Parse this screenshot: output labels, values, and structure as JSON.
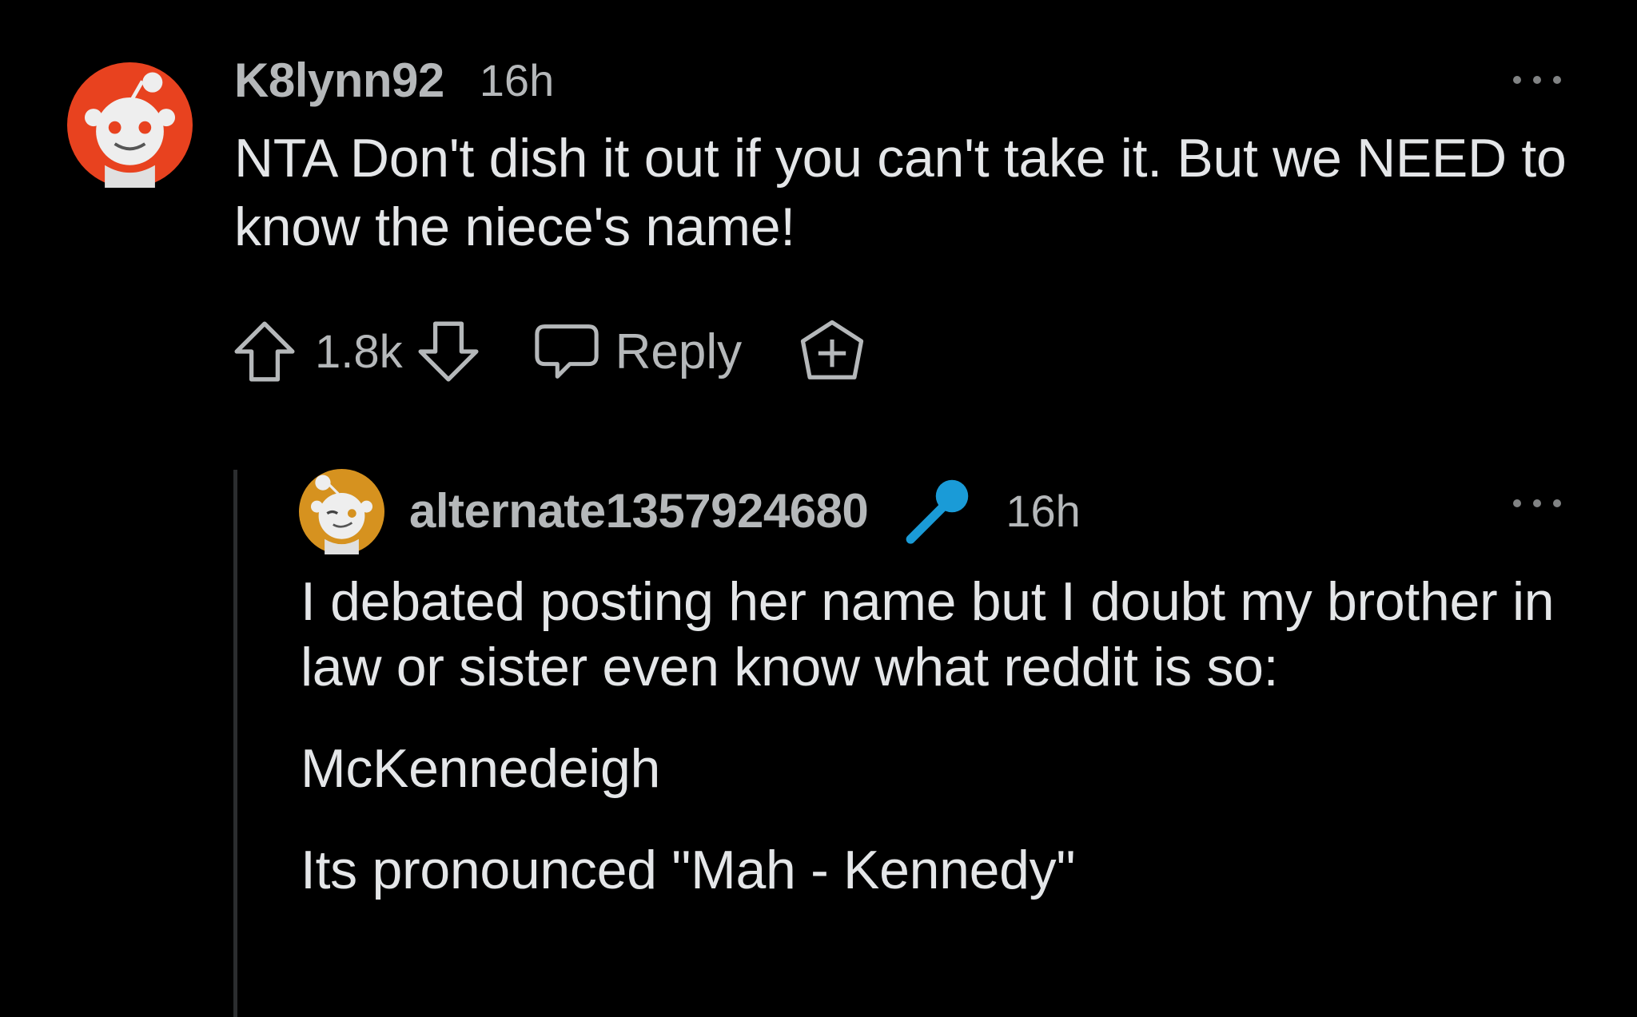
{
  "comments": [
    {
      "username": "K8lynn92",
      "time": "16h",
      "body": "NTA Don't dish it out if you can't take it. But we NEED to know the niece's name!",
      "votes": "1.8k",
      "reply_label": "Reply",
      "avatar_icon": "snoo-avatar-icon",
      "avatar_color": "#e8421f"
    },
    {
      "username": "alternate1357924680",
      "time": "16h",
      "flair_icon": "microphone-icon",
      "flair_color": "#1a9bd7",
      "avatar_icon": "snoo-avatar-icon",
      "avatar_color": "#d6921f",
      "paragraphs": [
        "I debated posting her name but I doubt my brother in law or sister even know what reddit is so:",
        "McKennedeigh",
        "Its pronounced \"Mah - Kennedy\""
      ]
    }
  ],
  "icons": {
    "more": "more-options-icon",
    "upvote": "upvote-arrow-icon",
    "downvote": "downvote-arrow-icon",
    "reply": "speech-bubble-icon",
    "award": "award-plus-icon"
  }
}
